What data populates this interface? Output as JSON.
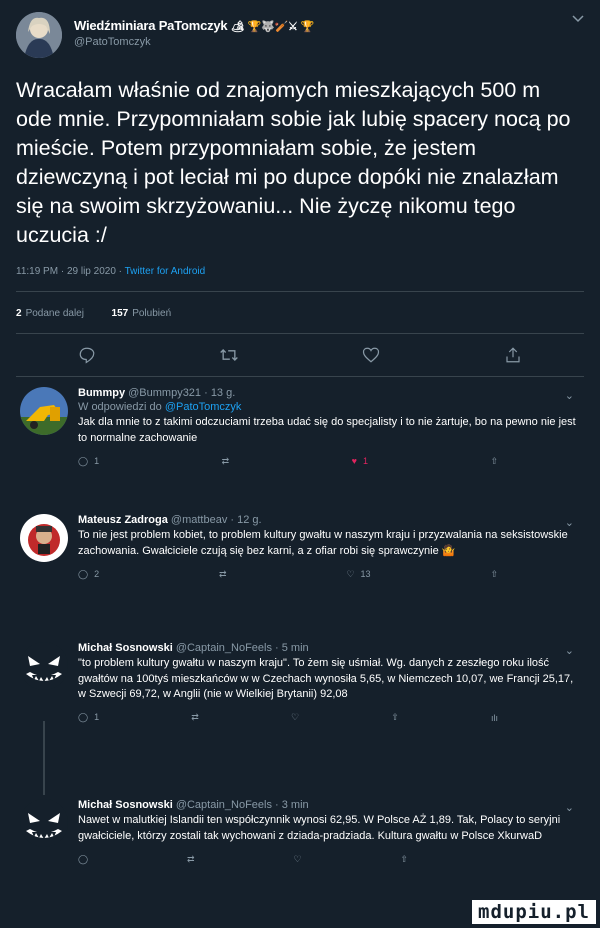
{
  "main_tweet": {
    "name": "Wiedźminiara PaTomczyk",
    "name_emojis": "🏕 🏆🐺🏏⚔ 🏆",
    "handle": "@PatoTomczyk",
    "text": "Wracałam właśnie od znajomych mieszkających 500 m ode mnie. Przypomniałam sobie jak lubię spacery nocą po mieście. Potem przypomniałam sobie, że jestem dziewczyną i pot leciał mi po dupce dopóki nie znalazłam się na swoim skrzyżowaniu... Nie życzę nikomu tego uczucia :/",
    "timestamp": "11:19 PM · 29 lip 2020 · ",
    "source": "Twitter for Android",
    "retweets_count": "2",
    "retweets_label": "Podane dalej",
    "likes_count": "157",
    "likes_label": "Polubień"
  },
  "replies": [
    {
      "name": "Bummpy",
      "handle": "@Bummpy321 · 13 g.",
      "in_reply_prefix": "W odpowiedzi do ",
      "in_reply_handle": "@PatoTomczyk",
      "text": "Jak dla mnie to z takimi odczuciami trzeba udać się do specjalisty i to nie żartuje, bo na pewno nie jest to normalne zachowanie",
      "reply_count": "1",
      "retweet_count": "",
      "like_count": "1",
      "liked": true
    },
    {
      "name": "Mateusz Zadroga",
      "handle": "@mattbeav · 12 g.",
      "text": "To nie jest problem kobiet, to problem kultury gwałtu w naszym kraju i przyzwalania na seksistowskie zachowania. Gwałciciele czują się bez karni, a z ofiar robi się sprawczynie 🤷",
      "reply_count": "2",
      "retweet_count": "",
      "like_count": "13",
      "liked": false
    },
    {
      "name": "Michał Sosnowski",
      "handle": "@Captain_NoFeels · 5 min",
      "text": "\"to problem kultury gwałtu w naszym kraju\". To żem się uśmiał. Wg. danych z zeszłego roku ilość gwałtów na 100tyś mieszkańców w w Czechach wynosiła 5,65, w Niemczech 10,07, we Francji 25,17, w Szwecji 69,72, w Anglii (nie w Wielkiej Brytanii) 92,08",
      "reply_count": "1",
      "retweet_count": "",
      "like_count": "",
      "liked": false
    },
    {
      "name": "Michał Sosnowski",
      "handle": "@Captain_NoFeels · 3 min",
      "text": "Nawet w malutkiej Islandii ten współczynnik wynosi 62,95. W Polsce AŻ 1,89. Tak, Polacy to seryjni gwałciciele, którzy zostali tak wychowani z dziada-pradziada. Kultura gwałtu w Polsce XkurwaD",
      "reply_count": "",
      "retweet_count": "",
      "like_count": "",
      "liked": false
    }
  ],
  "watermark": "mdupiu.pl",
  "colors": {
    "background": "#15202b",
    "muted": "#8899a6",
    "link": "#1da1f2",
    "like_active": "#e0245e",
    "divider": "#38444d"
  }
}
